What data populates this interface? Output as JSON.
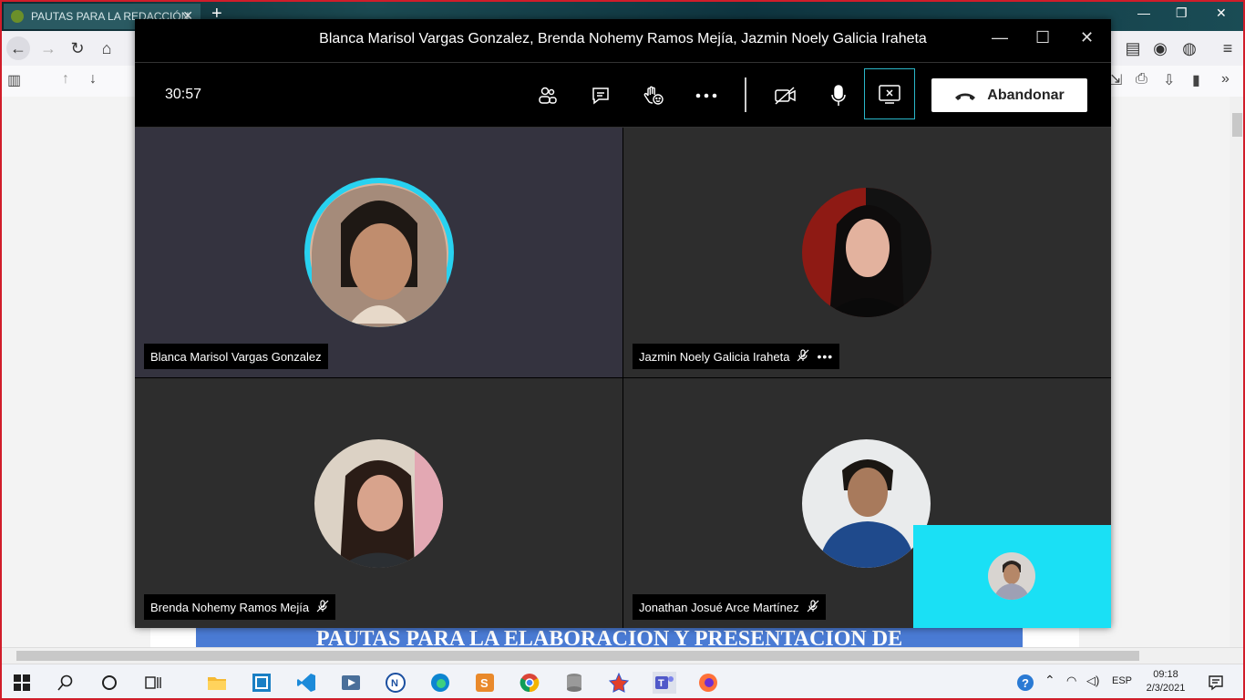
{
  "browser": {
    "tab_title": "PAUTAS PARA LA REDACCIÓN",
    "tab_close": "✕",
    "new_tab": "+"
  },
  "document": {
    "heading": "PAUTAS PARA LA ELABORACION Y PRESENTACION DE"
  },
  "teams": {
    "window_title": "Blanca Marisol Vargas Gonzalez, Brenda Nohemy Ramos Mejía, Jazmin Noely Galicia Iraheta",
    "timer": "30:57",
    "leave_label": "Abandonar",
    "participants": [
      {
        "name": "Blanca Marisol Vargas Gonzalez",
        "muted": false,
        "speaking": true
      },
      {
        "name": "Jazmin Noely Galicia Iraheta",
        "muted": true,
        "speaking": false
      },
      {
        "name": "Brenda Nohemy Ramos Mejía",
        "muted": true,
        "speaking": false
      },
      {
        "name": "Jonathan Josué Arce Martínez",
        "muted": true,
        "speaking": false
      }
    ],
    "colors": {
      "tile_active": "#34333f",
      "tile": "#2d2d2d",
      "speaking_ring": "#28d2f0",
      "self_view": "#1ae0f5"
    }
  },
  "taskbar": {
    "language": "ESP",
    "time": "09:18",
    "date": "2/3/2021"
  }
}
